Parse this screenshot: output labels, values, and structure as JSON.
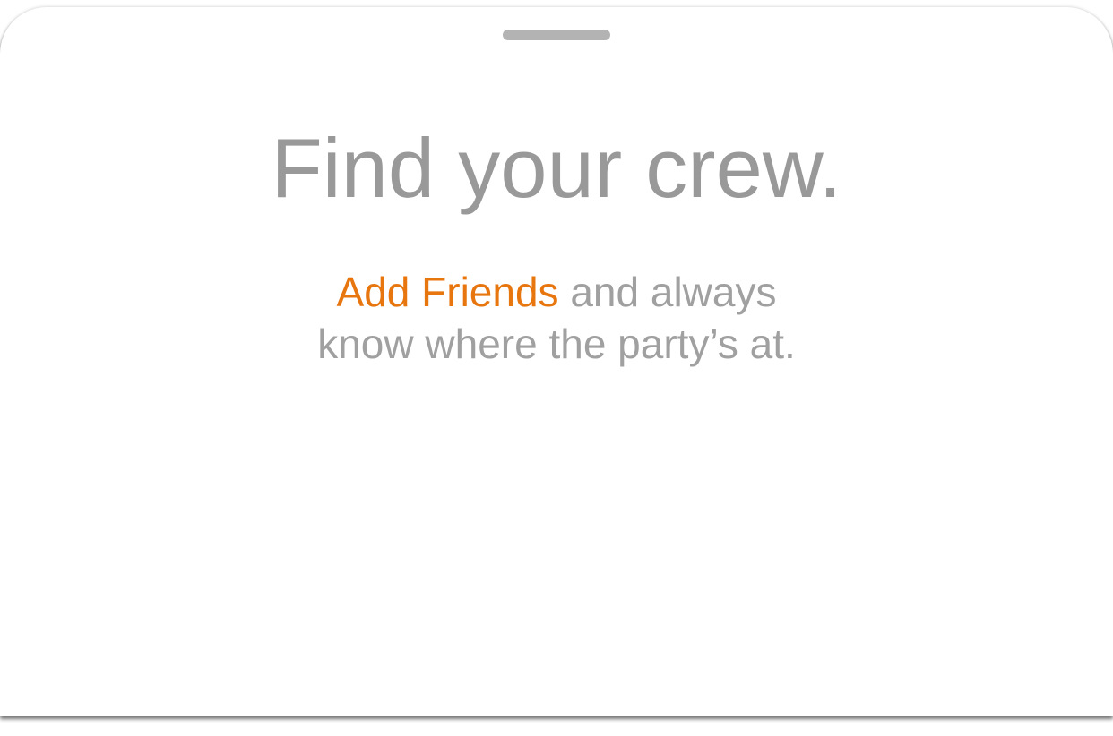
{
  "sheet": {
    "grabber_color": "#b3b3b3"
  },
  "headline": {
    "text": "Find your crew.",
    "color": "#999999"
  },
  "subtext": {
    "link_text": "Add Friends",
    "line1_rest": " and always",
    "line2": "know where the party’s at.",
    "text_color": "#a0a0a0",
    "link_color": "#e8760f"
  }
}
